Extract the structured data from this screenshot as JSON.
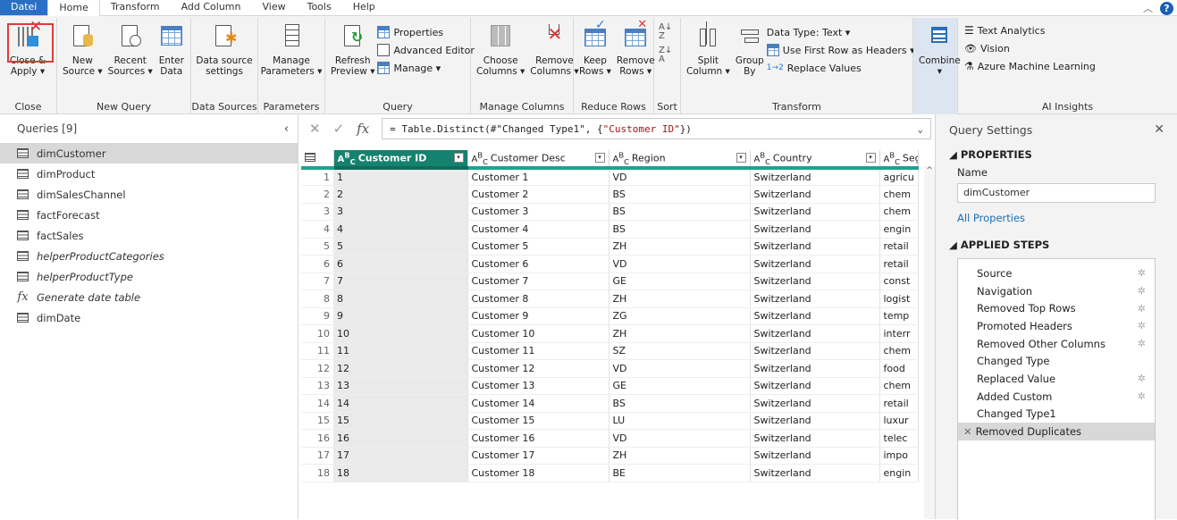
{
  "tabs": [
    {
      "label": "Datei"
    },
    {
      "label": "Home"
    },
    {
      "label": "Transform"
    },
    {
      "label": "Add Column"
    },
    {
      "label": "View"
    },
    {
      "label": "Tools"
    },
    {
      "label": "Help"
    }
  ],
  "help_label": "?",
  "ribbon": {
    "close": {
      "btn": "Close &\nApply ▾",
      "group": "Close"
    },
    "newquery": {
      "new": "New\nSource ▾",
      "recent": "Recent\nSources ▾",
      "enter": "Enter\nData",
      "group": "New Query"
    },
    "datasources": {
      "btn": "Data source\nsettings",
      "group": "Data Sources"
    },
    "parameters": {
      "btn": "Manage\nParameters ▾",
      "group": "Parameters"
    },
    "query": {
      "refresh": "Refresh\nPreview ▾",
      "properties": "Properties",
      "advanced": "Advanced Editor",
      "manage": "Manage ▾",
      "group": "Query"
    },
    "managecols": {
      "choose": "Choose\nColumns ▾",
      "remove": "Remove\nColumns ▾",
      "group": "Manage Columns"
    },
    "reducerows": {
      "keep": "Keep\nRows ▾",
      "remove": "Remove\nRows ▾",
      "group": "Reduce Rows"
    },
    "sort": {
      "group": "Sort"
    },
    "transform": {
      "split": "Split\nColumn ▾",
      "groupby": "Group\nBy",
      "datatype": "Data Type: Text ▾",
      "firstrow": "Use First Row as Headers ▾",
      "replace": "Replace Values",
      "group": "Transform"
    },
    "combine": {
      "btn": "Combine\n▾"
    },
    "ai": {
      "text": "Text Analytics",
      "vision": "Vision",
      "azure": "Azure Machine Learning",
      "group": "AI Insights"
    }
  },
  "queries": {
    "title": "Queries [9]",
    "items": [
      {
        "label": "dimCustomer",
        "kind": "table",
        "selected": true
      },
      {
        "label": "dimProduct",
        "kind": "table"
      },
      {
        "label": "dimSalesChannel",
        "kind": "table"
      },
      {
        "label": "factForecast",
        "kind": "table"
      },
      {
        "label": "factSales",
        "kind": "table"
      },
      {
        "label": "helperProductCategories",
        "kind": "table",
        "italic": true
      },
      {
        "label": "helperProductType",
        "kind": "table",
        "italic": true
      },
      {
        "label": "Generate date table",
        "kind": "function",
        "italic": true
      },
      {
        "label": "dimDate",
        "kind": "table"
      }
    ]
  },
  "formula": {
    "prefix": "= Table.Distinct(#\"Changed Type1\", {",
    "string": "\"Customer ID\"",
    "suffix": "})"
  },
  "grid": {
    "columns": [
      "Customer ID",
      "Customer Desc",
      "Region",
      "Country",
      "Segm"
    ],
    "rows": [
      [
        "1",
        "1",
        "Customer 1",
        "VD",
        "Switzerland",
        "agricu"
      ],
      [
        "2",
        "2",
        "Customer 2",
        "BS",
        "Switzerland",
        "chem"
      ],
      [
        "3",
        "3",
        "Customer 3",
        "BS",
        "Switzerland",
        "chem"
      ],
      [
        "4",
        "4",
        "Customer 4",
        "BS",
        "Switzerland",
        "engin"
      ],
      [
        "5",
        "5",
        "Customer 5",
        "ZH",
        "Switzerland",
        "retail"
      ],
      [
        "6",
        "6",
        "Customer 6",
        "VD",
        "Switzerland",
        "retail"
      ],
      [
        "7",
        "7",
        "Customer 7",
        "GE",
        "Switzerland",
        "const"
      ],
      [
        "8",
        "8",
        "Customer 8",
        "ZH",
        "Switzerland",
        "logist"
      ],
      [
        "9",
        "9",
        "Customer 9",
        "ZG",
        "Switzerland",
        "temp"
      ],
      [
        "10",
        "10",
        "Customer 10",
        "ZH",
        "Switzerland",
        "interr"
      ],
      [
        "11",
        "11",
        "Customer 11",
        "SZ",
        "Switzerland",
        "chem"
      ],
      [
        "12",
        "12",
        "Customer 12",
        "VD",
        "Switzerland",
        "food"
      ],
      [
        "13",
        "13",
        "Customer 13",
        "GE",
        "Switzerland",
        "chem"
      ],
      [
        "14",
        "14",
        "Customer 14",
        "BS",
        "Switzerland",
        "retail"
      ],
      [
        "15",
        "15",
        "Customer 15",
        "LU",
        "Switzerland",
        "luxur"
      ],
      [
        "16",
        "16",
        "Customer 16",
        "VD",
        "Switzerland",
        "telec"
      ],
      [
        "17",
        "17",
        "Customer 17",
        "ZH",
        "Switzerland",
        "impo"
      ],
      [
        "18",
        "18",
        "Customer 18",
        "BE",
        "Switzerland",
        "engin"
      ]
    ]
  },
  "settings": {
    "title": "Query Settings",
    "properties_label": "◢ PROPERTIES",
    "name_label": "Name",
    "name_value": "dimCustomer",
    "all_properties": "All Properties",
    "steps_label": "◢ APPLIED STEPS",
    "steps": [
      {
        "label": "Source",
        "gear": true
      },
      {
        "label": "Navigation",
        "gear": true
      },
      {
        "label": "Removed Top Rows",
        "gear": true
      },
      {
        "label": "Promoted Headers",
        "gear": true
      },
      {
        "label": "Removed Other Columns",
        "gear": true
      },
      {
        "label": "Changed Type",
        "gear": false
      },
      {
        "label": "Replaced Value",
        "gear": true
      },
      {
        "label": "Added Custom",
        "gear": true
      },
      {
        "label": "Changed Type1",
        "gear": false
      },
      {
        "label": "Removed Duplicates",
        "gear": false,
        "selected": true
      }
    ]
  },
  "colors": {
    "accent": "#14826f",
    "highlight": "#e03a3a",
    "link": "#1a6fb5"
  }
}
